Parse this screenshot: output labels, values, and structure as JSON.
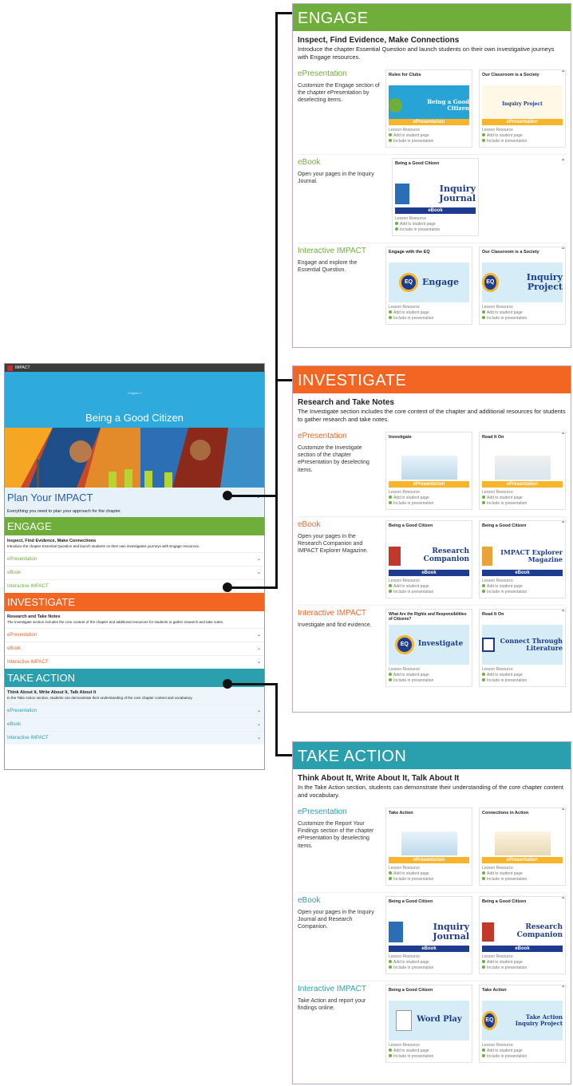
{
  "app": {
    "brand": "IMPACT",
    "hero_subtitle": "Chapter 1",
    "hero_title": "Being a Good Citizen",
    "plan": {
      "title": "Plan Your IMPACT",
      "desc": "Everything you need to plan your approach for the chapter."
    },
    "engage": {
      "title": "ENGAGE",
      "sub": "Inspect, Find Evidence, Make Connections",
      "desc": "Introduce the chapter Essential Question and launch students on their own investigative journeys with Engage resources.",
      "rows": [
        "ePresentation",
        "eBook",
        "Interactive IMPACT"
      ]
    },
    "investigate": {
      "title": "INVESTIGATE",
      "sub": "Research and Take Notes",
      "desc": "The Investigate section includes the core content of the chapter and additional resources for students to gather research and take notes.",
      "rows": [
        "ePresentation",
        "eBook",
        "Interactive IMPACT"
      ]
    },
    "take_action": {
      "title": "TAKE ACTION",
      "sub": "Think About It, Write About It, Talk About It",
      "desc": "In the Take Action section, students can demonstrate their understanding of the core chapter content and vocabulary.",
      "rows": [
        "ePresentation",
        "eBook",
        "Interactive IMPACT"
      ]
    }
  },
  "engage_panel": {
    "title": "ENGAGE",
    "sub": "Inspect, Find Evidence, Make Connections",
    "desc": "Introduce the chapter Essential Question and launch students on their own investigative journeys with Engage resources.",
    "rows": [
      {
        "head": "ePresentation",
        "desc": "Customize the Engage section of the chapter ePresentation by deselecting items.",
        "cards": [
          {
            "title": "Rules for Clubs",
            "thumb": "Being a Good Citizen",
            "strip": "ePresentation"
          },
          {
            "title": "Our Classroom is a Society",
            "thumb": "Inquiry Project",
            "strip": "ePresentation"
          }
        ]
      },
      {
        "head": "eBook",
        "desc": "Open your pages in the Inquiry Journal.",
        "cards": [
          {
            "title": "Being a Good Citizen",
            "thumb": "Inquiry Journal",
            "strip": "eBook"
          }
        ]
      },
      {
        "head": "Interactive IMPACT",
        "desc": "Engage and explore the Essential Question.",
        "cards": [
          {
            "title": "Engage with the EQ",
            "thumb": "Engage",
            "strip": ""
          },
          {
            "title": "Our Classroom is a Society",
            "thumb": "Inquiry Project",
            "strip": ""
          }
        ]
      }
    ]
  },
  "investigate_panel": {
    "title": "INVESTIGATE",
    "sub": "Research and Take Notes",
    "desc": "The Investigate section includes the core content of the chapter and additional resources for students to gather research and take notes.",
    "rows": [
      {
        "head": "ePresentation",
        "desc": "Customize the Investigate section of the chapter ePresentation by deselecting items.",
        "cards": [
          {
            "title": "Investigate",
            "thumb": "",
            "strip": "ePresentation"
          },
          {
            "title": "Read It On",
            "thumb": "",
            "strip": "ePresentation"
          }
        ]
      },
      {
        "head": "eBook",
        "desc": "Open your pages in the Research Companion and IMPACT Explorer Magazine.",
        "cards": [
          {
            "title": "Being a Good Citizen",
            "thumb": "Research Companion",
            "strip": "eBook"
          },
          {
            "title": "Being a Good Citizen",
            "thumb": "IMPACT Explorer Magazine",
            "strip": "eBook"
          }
        ]
      },
      {
        "head": "Interactive IMPACT",
        "desc": "Investigate and find evidence.",
        "cards": [
          {
            "title": "What Are the Rights and Responsibilities of Citizens?",
            "thumb": "Investigate",
            "strip": ""
          },
          {
            "title": "Read It On",
            "thumb": "Connect Through Literature",
            "strip": ""
          }
        ]
      }
    ]
  },
  "take_action_panel": {
    "title": "TAKE ACTION",
    "sub": "Think About It, Write About It, Talk About It",
    "desc": "In the Take Action section, students can demonstrate their understanding of the core chapter content and vocabulary.",
    "rows": [
      {
        "head": "ePresentation",
        "desc": "Customize the Report Your Findings section of the chapter ePresentation by deselecting items.",
        "cards": [
          {
            "title": "Take Action",
            "thumb": "",
            "strip": "ePresentation"
          },
          {
            "title": "Connections in Action",
            "thumb": "",
            "strip": "ePresentation"
          }
        ]
      },
      {
        "head": "eBook",
        "desc": "Open your pages in the Inquiry Journal and Research Companion.",
        "cards": [
          {
            "title": "Being a Good Citizen",
            "thumb": "Inquiry Journal",
            "strip": "eBook"
          },
          {
            "title": "Being a Good Citizen",
            "thumb": "Research Companion",
            "strip": "eBook"
          }
        ]
      },
      {
        "head": "Interactive IMPACT",
        "desc": "Take Action and report your findings online.",
        "cards": [
          {
            "title": "Being a Good Citizen",
            "thumb": "Word Play",
            "strip": ""
          },
          {
            "title": "Take Action",
            "thumb": "Take Action Inquiry Project",
            "strip": ""
          }
        ]
      }
    ]
  },
  "card_meta": {
    "line1": "Lesson Resource",
    "line2": "Add to student page",
    "line3": "Include in presentation"
  },
  "colors": {
    "engage": "#6fae3a",
    "investigate": "#f26522",
    "take_action": "#2a9fae",
    "plan": "#2a5db0"
  }
}
